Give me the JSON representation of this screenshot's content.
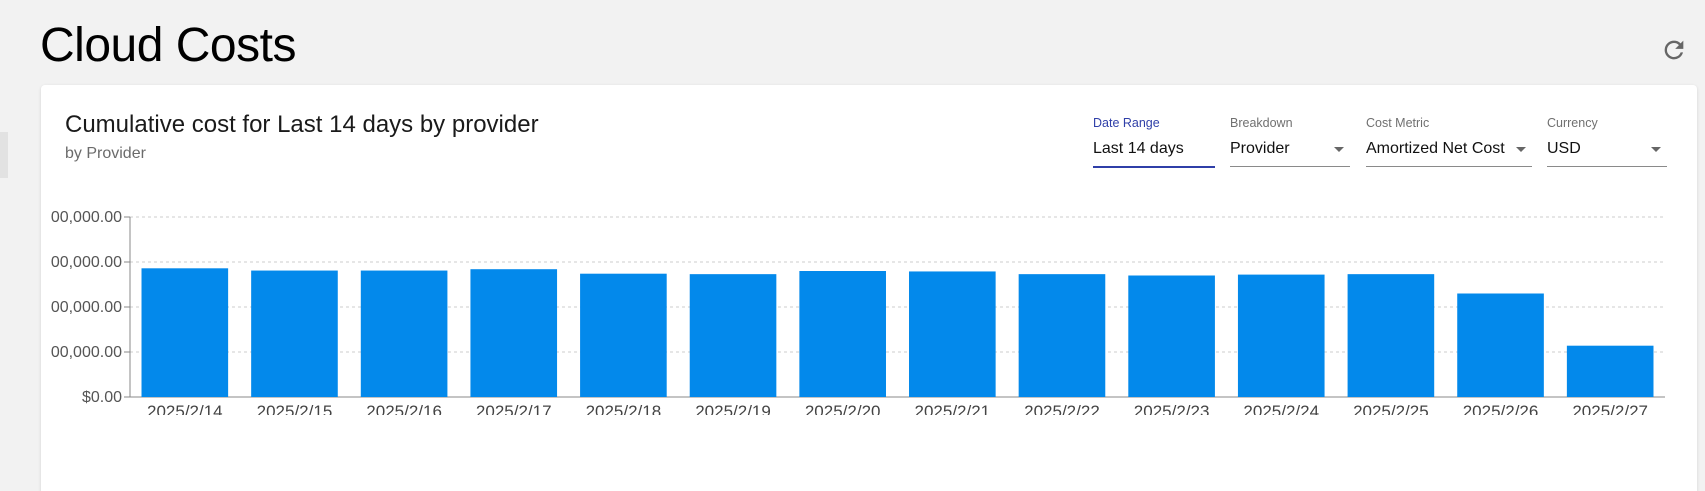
{
  "page": {
    "title": "Cloud Costs",
    "refresh_icon": "refresh-icon"
  },
  "card": {
    "title": "Cumulative cost for Last 14 days by provider",
    "subtitle": "by Provider"
  },
  "controls": {
    "date_range": {
      "label": "Date Range",
      "value": "Last 14 days"
    },
    "breakdown": {
      "label": "Breakdown",
      "value": "Provider"
    },
    "cost_metric": {
      "label": "Cost Metric",
      "value": "Amortized Net Cost"
    },
    "currency": {
      "label": "Currency",
      "value": "USD"
    }
  },
  "colors": {
    "bar": "#0389eb",
    "accent": "#2f3fa8",
    "grid": "#cccccc",
    "axis": "#888888"
  },
  "chart_data": {
    "type": "bar",
    "categories": [
      "2025/2/14",
      "2025/2/15",
      "2025/2/16",
      "2025/2/17",
      "2025/2/18",
      "2025/2/19",
      "2025/2/20",
      "2025/2/21",
      "2025/2/22",
      "2025/2/23",
      "2025/2/24",
      "2025/2/25",
      "2025/2/26",
      "2025/2/27"
    ],
    "values": [
      2.86,
      2.81,
      2.81,
      2.84,
      2.74,
      2.73,
      2.8,
      2.79,
      2.73,
      2.7,
      2.72,
      2.73,
      2.3,
      1.14
    ],
    "y_ticks": [
      0,
      1,
      2,
      3,
      4
    ],
    "y_tick_labels": [
      "$0.00",
      "00,000.00",
      "00,000.00",
      "00,000.00",
      "00,000.00"
    ],
    "ylim": [
      0,
      4
    ],
    "grid": true,
    "legend": "none"
  }
}
